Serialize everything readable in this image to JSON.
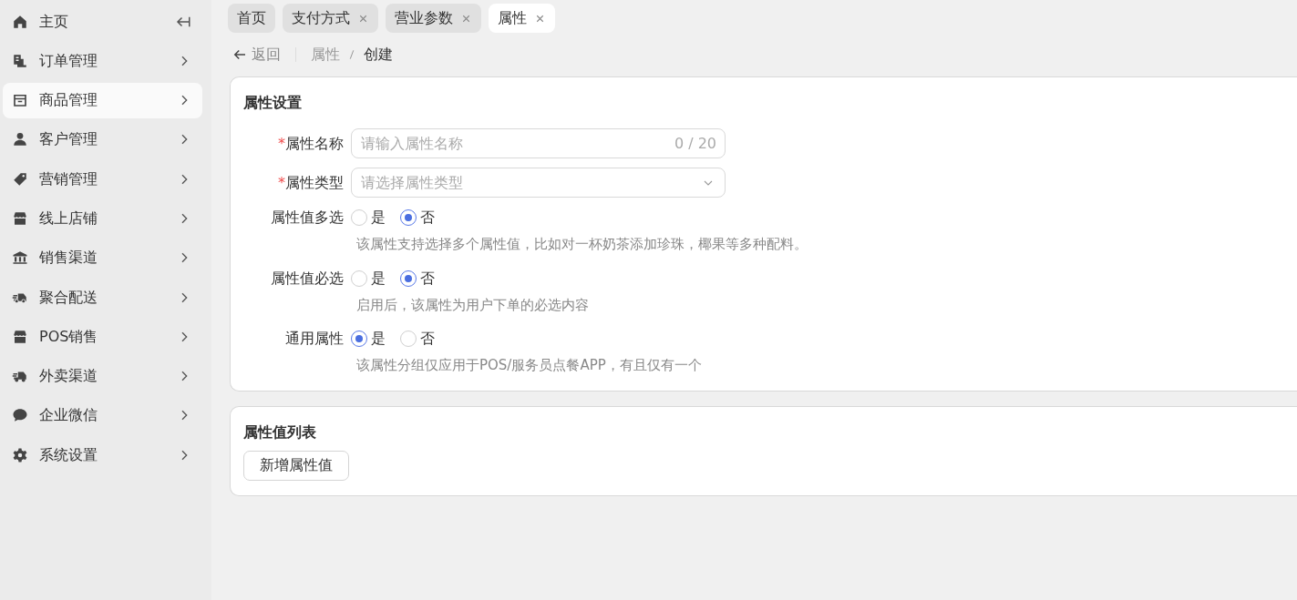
{
  "sidebar": {
    "items": [
      {
        "label": "主页",
        "selected": false,
        "has_arrow": false
      },
      {
        "label": "订单管理",
        "selected": false,
        "has_arrow": true
      },
      {
        "label": "商品管理",
        "selected": true,
        "has_arrow": true
      },
      {
        "label": "客户管理",
        "selected": false,
        "has_arrow": true
      },
      {
        "label": "营销管理",
        "selected": false,
        "has_arrow": true
      },
      {
        "label": "线上店铺",
        "selected": false,
        "has_arrow": true
      },
      {
        "label": "销售渠道",
        "selected": false,
        "has_arrow": true
      },
      {
        "label": "聚合配送",
        "selected": false,
        "has_arrow": true
      },
      {
        "label": "POS销售",
        "selected": false,
        "has_arrow": true
      },
      {
        "label": "外卖渠道",
        "selected": false,
        "has_arrow": true
      },
      {
        "label": "企业微信",
        "selected": false,
        "has_arrow": true
      },
      {
        "label": "系统设置",
        "selected": false,
        "has_arrow": true
      }
    ]
  },
  "tabs": [
    {
      "label": "首页",
      "selected": false,
      "closable": false
    },
    {
      "label": "支付方式",
      "selected": false,
      "closable": true
    },
    {
      "label": "营业参数",
      "selected": false,
      "closable": true
    },
    {
      "label": "属性",
      "selected": true,
      "closable": true
    }
  ],
  "header": {
    "back": "返回",
    "breadcrumb": [
      "属性",
      "创建"
    ]
  },
  "settings_card": {
    "title": "属性设置",
    "fields": [
      {
        "kind": "text",
        "required_mark": "*",
        "label": "属性名称",
        "placeholder": "请输入属性名称",
        "counter": "0 / 20"
      },
      {
        "kind": "select",
        "required_mark": "*",
        "label": "属性类型",
        "placeholder": "请选择属性类型"
      },
      {
        "kind": "radio",
        "label": "属性值多选",
        "options": [
          {
            "label": "是",
            "selected": false
          },
          {
            "label": "否",
            "selected": true
          }
        ],
        "help": "该属性支持选择多个属性值，比如对一杯奶茶添加珍珠，椰果等多种配料。"
      },
      {
        "kind": "radio",
        "label": "属性值必选",
        "options": [
          {
            "label": "是",
            "selected": false
          },
          {
            "label": "否",
            "selected": true
          }
        ],
        "help": "启用后，该属性为用户下单的必选内容"
      },
      {
        "kind": "radio",
        "label": "通用属性",
        "options": [
          {
            "label": "是",
            "selected": true
          },
          {
            "label": "否",
            "selected": false
          }
        ],
        "help": "该属性分组仅应用于POS/服务员点餐APP，有且仅有一个"
      }
    ]
  },
  "values_card": {
    "title": "属性值列表",
    "button": "新增属性值"
  }
}
